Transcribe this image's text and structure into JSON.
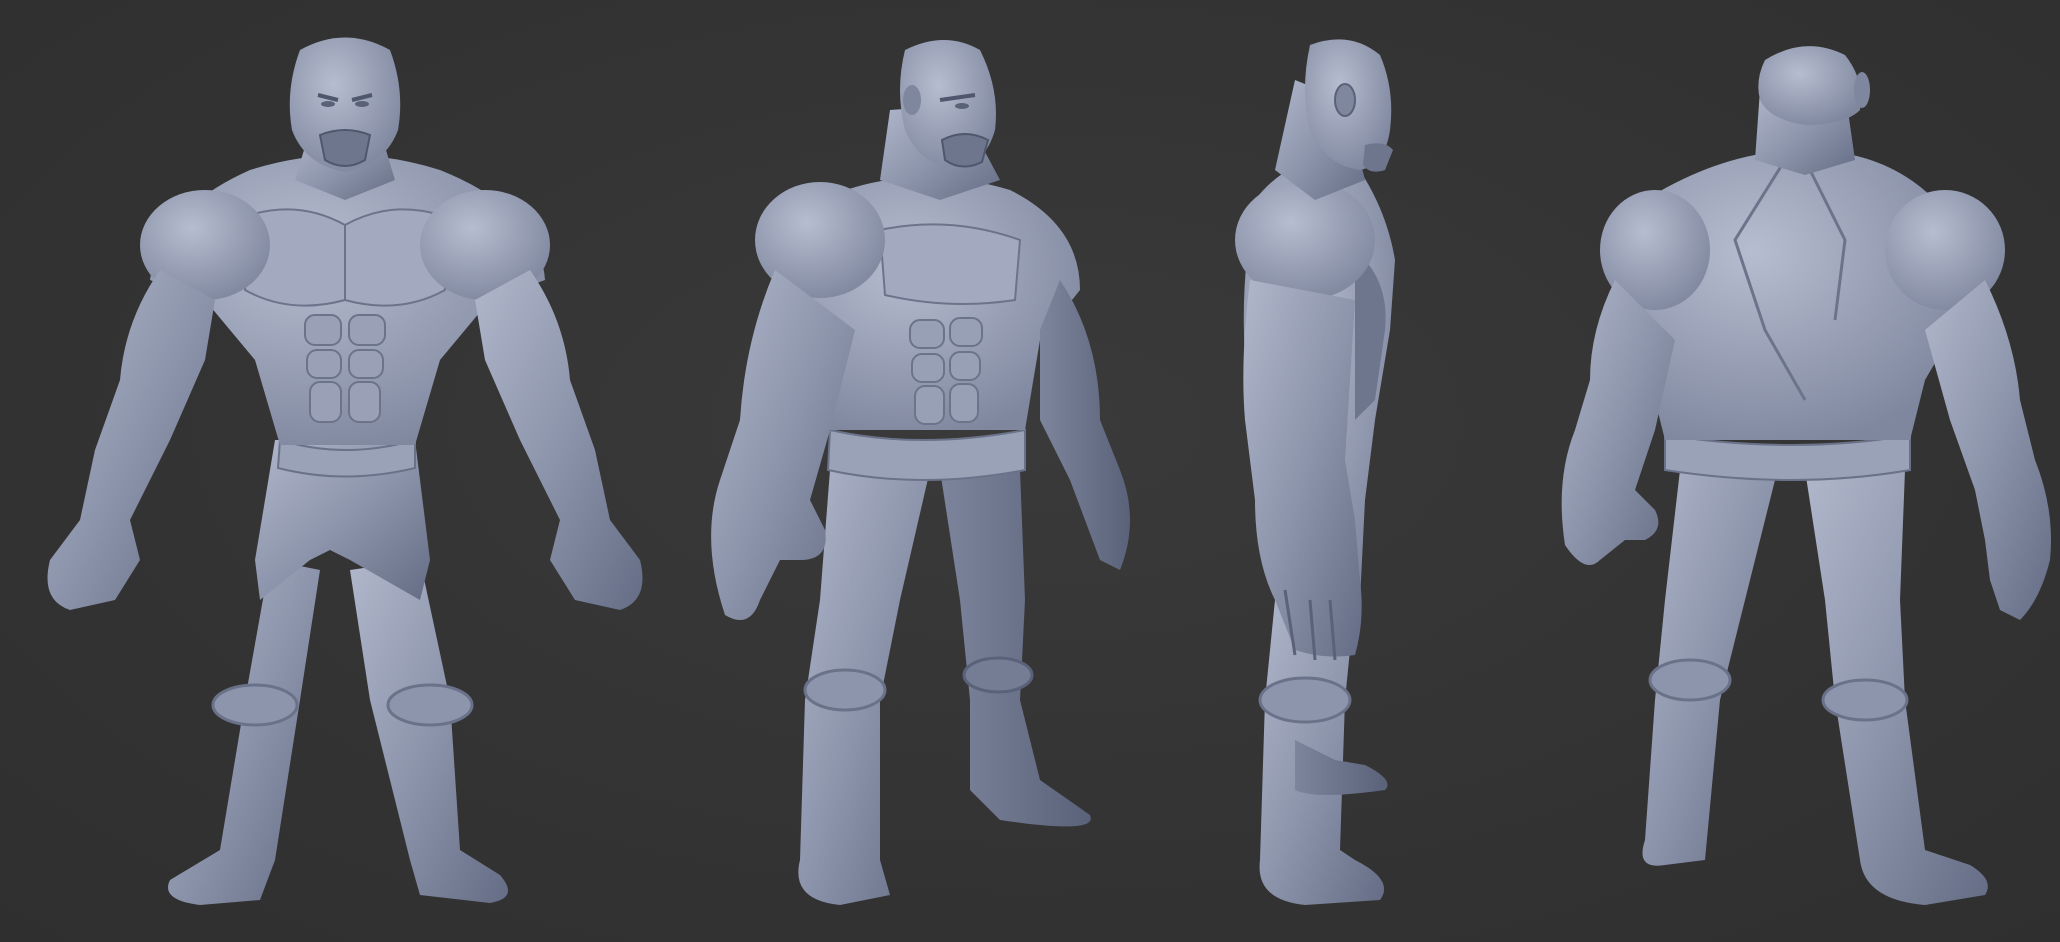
{
  "scene": {
    "background_color": "#343434",
    "material_color": "#8e96ad",
    "material_shadow": "#5f6780",
    "material_highlight": "#b4bbcf"
  },
  "figures": [
    {
      "view": "front"
    },
    {
      "view": "three-quarter"
    },
    {
      "view": "side"
    },
    {
      "view": "back"
    }
  ]
}
